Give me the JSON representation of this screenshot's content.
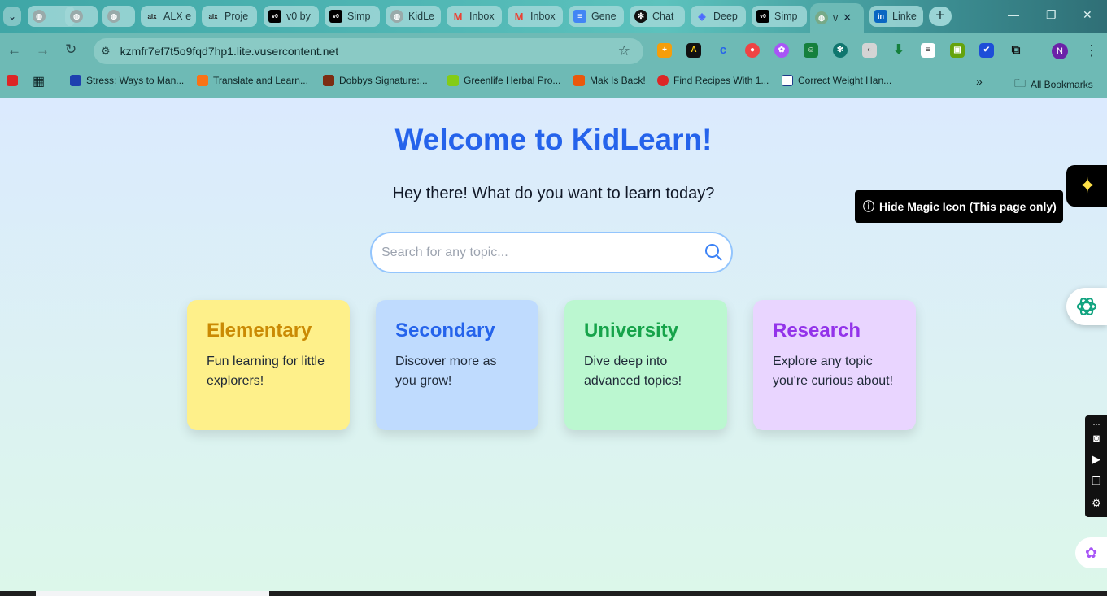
{
  "browser": {
    "tabs": [
      {
        "title": "",
        "icon": "globe-icon"
      },
      {
        "title": "",
        "icon": "globe-icon"
      },
      {
        "title": "",
        "icon": "globe-icon"
      },
      {
        "title": "ALX e",
        "icon": "alx-icon"
      },
      {
        "title": "Proje",
        "icon": "alx-icon"
      },
      {
        "title": "v0 by",
        "icon": "v0-icon"
      },
      {
        "title": "Simp",
        "icon": "v0-icon"
      },
      {
        "title": "KidLe",
        "icon": "globe-icon"
      },
      {
        "title": "Inbox",
        "icon": "gmail-icon"
      },
      {
        "title": "Inbox",
        "icon": "gmail-icon"
      },
      {
        "title": "Gene",
        "icon": "docs-icon"
      },
      {
        "title": "Chat",
        "icon": "openai-icon"
      },
      {
        "title": "Deep",
        "icon": "deepseek-icon"
      },
      {
        "title": "Simp",
        "icon": "v0-icon"
      },
      {
        "title": "v",
        "icon": "globe-icon",
        "active": true
      },
      {
        "title": "Linke",
        "icon": "linkedin-icon"
      }
    ],
    "new_tab_label": "+",
    "url": "kzmfr7ef7t5o9fqd7hp1.lite.vusercontent.net",
    "profile_initial": "N",
    "bookmarks": [
      {
        "label": "Stress: Ways to Man..."
      },
      {
        "label": "Translate and Learn..."
      },
      {
        "label": "Dobbys Signature:..."
      },
      {
        "label": "Greenlife Herbal Pro..."
      },
      {
        "label": "Mak Is Back!"
      },
      {
        "label": "Find Recipes With 1..."
      },
      {
        "label": "Correct Weight Han..."
      }
    ],
    "all_bookmarks_label": "All Bookmarks"
  },
  "page": {
    "title": "Welcome to KidLearn!",
    "subtitle": "Hey there! What do you want to learn today?",
    "search_placeholder": "Search for any topic...",
    "cards": [
      {
        "title": "Elementary",
        "desc": "Fun learning for little explorers!",
        "bg": "#fef08a",
        "color": "#ca8a04"
      },
      {
        "title": "Secondary",
        "desc": "Discover more as you grow!",
        "bg": "#bfdbfe",
        "color": "#2563eb"
      },
      {
        "title": "University",
        "desc": "Dive deep into advanced topics!",
        "bg": "#bbf7d0",
        "color": "#16a34a"
      },
      {
        "title": "Research",
        "desc": "Explore any topic you're curious about!",
        "bg": "#e9d5ff",
        "color": "#9333ea"
      }
    ]
  },
  "overlays": {
    "magic_tooltip": "Hide Magic Icon (This page only)"
  }
}
